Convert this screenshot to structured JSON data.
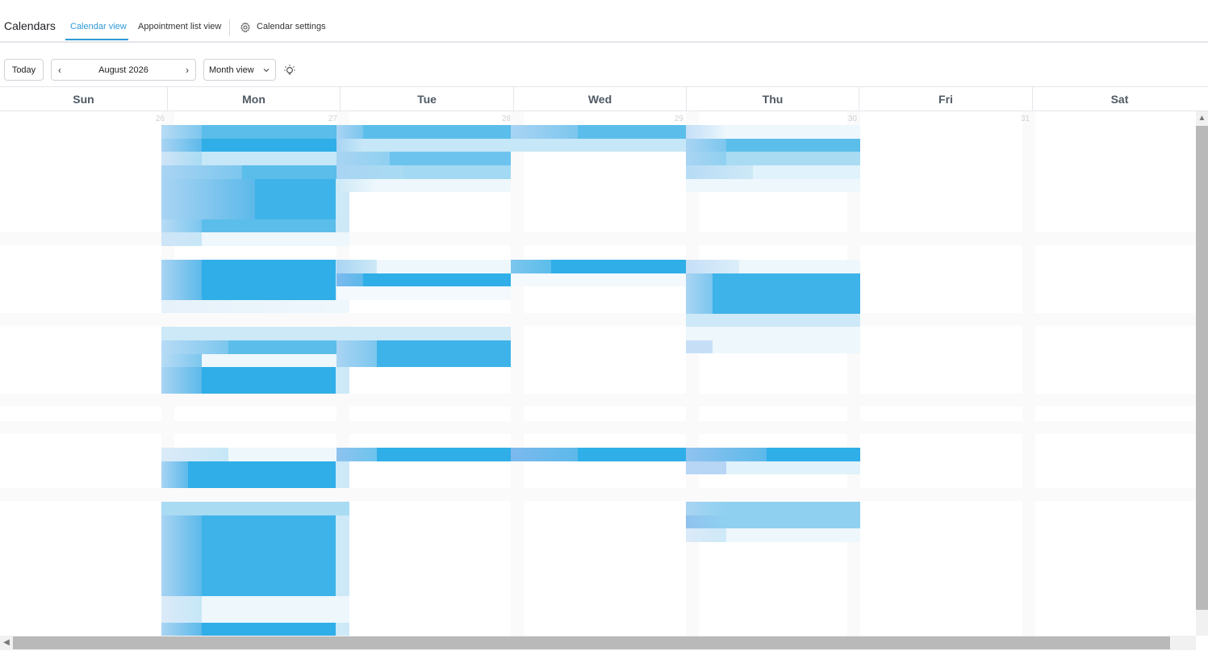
{
  "app": {
    "title": "Calendars"
  },
  "tabs": [
    {
      "label": "Calendar view",
      "active": true
    },
    {
      "label": "Appointment list view",
      "active": false
    },
    {
      "label": "Calendar settings",
      "active": false,
      "icon": "gear-icon"
    }
  ],
  "toolbar": {
    "today_label": "Today",
    "current_period": "August 2026",
    "prev_icon": "chevron-left-icon",
    "next_icon": "chevron-right-icon",
    "view_selected": "Month view",
    "theme_icon": "lightbulb-icon"
  },
  "calendar": {
    "day_names": [
      "Sun",
      "Mon",
      "Tue",
      "Wed",
      "Thu",
      "Fri",
      "Sat"
    ],
    "week_dates": [
      "26",
      "27",
      "28",
      "29",
      "30",
      "31"
    ]
  },
  "colors": {
    "accent": "#2f9ad8",
    "event_strong": "#2faee8",
    "event_mid": "#5bbdea",
    "event_light": "#cde9f7",
    "event_pale": "#eaf6fc"
  }
}
